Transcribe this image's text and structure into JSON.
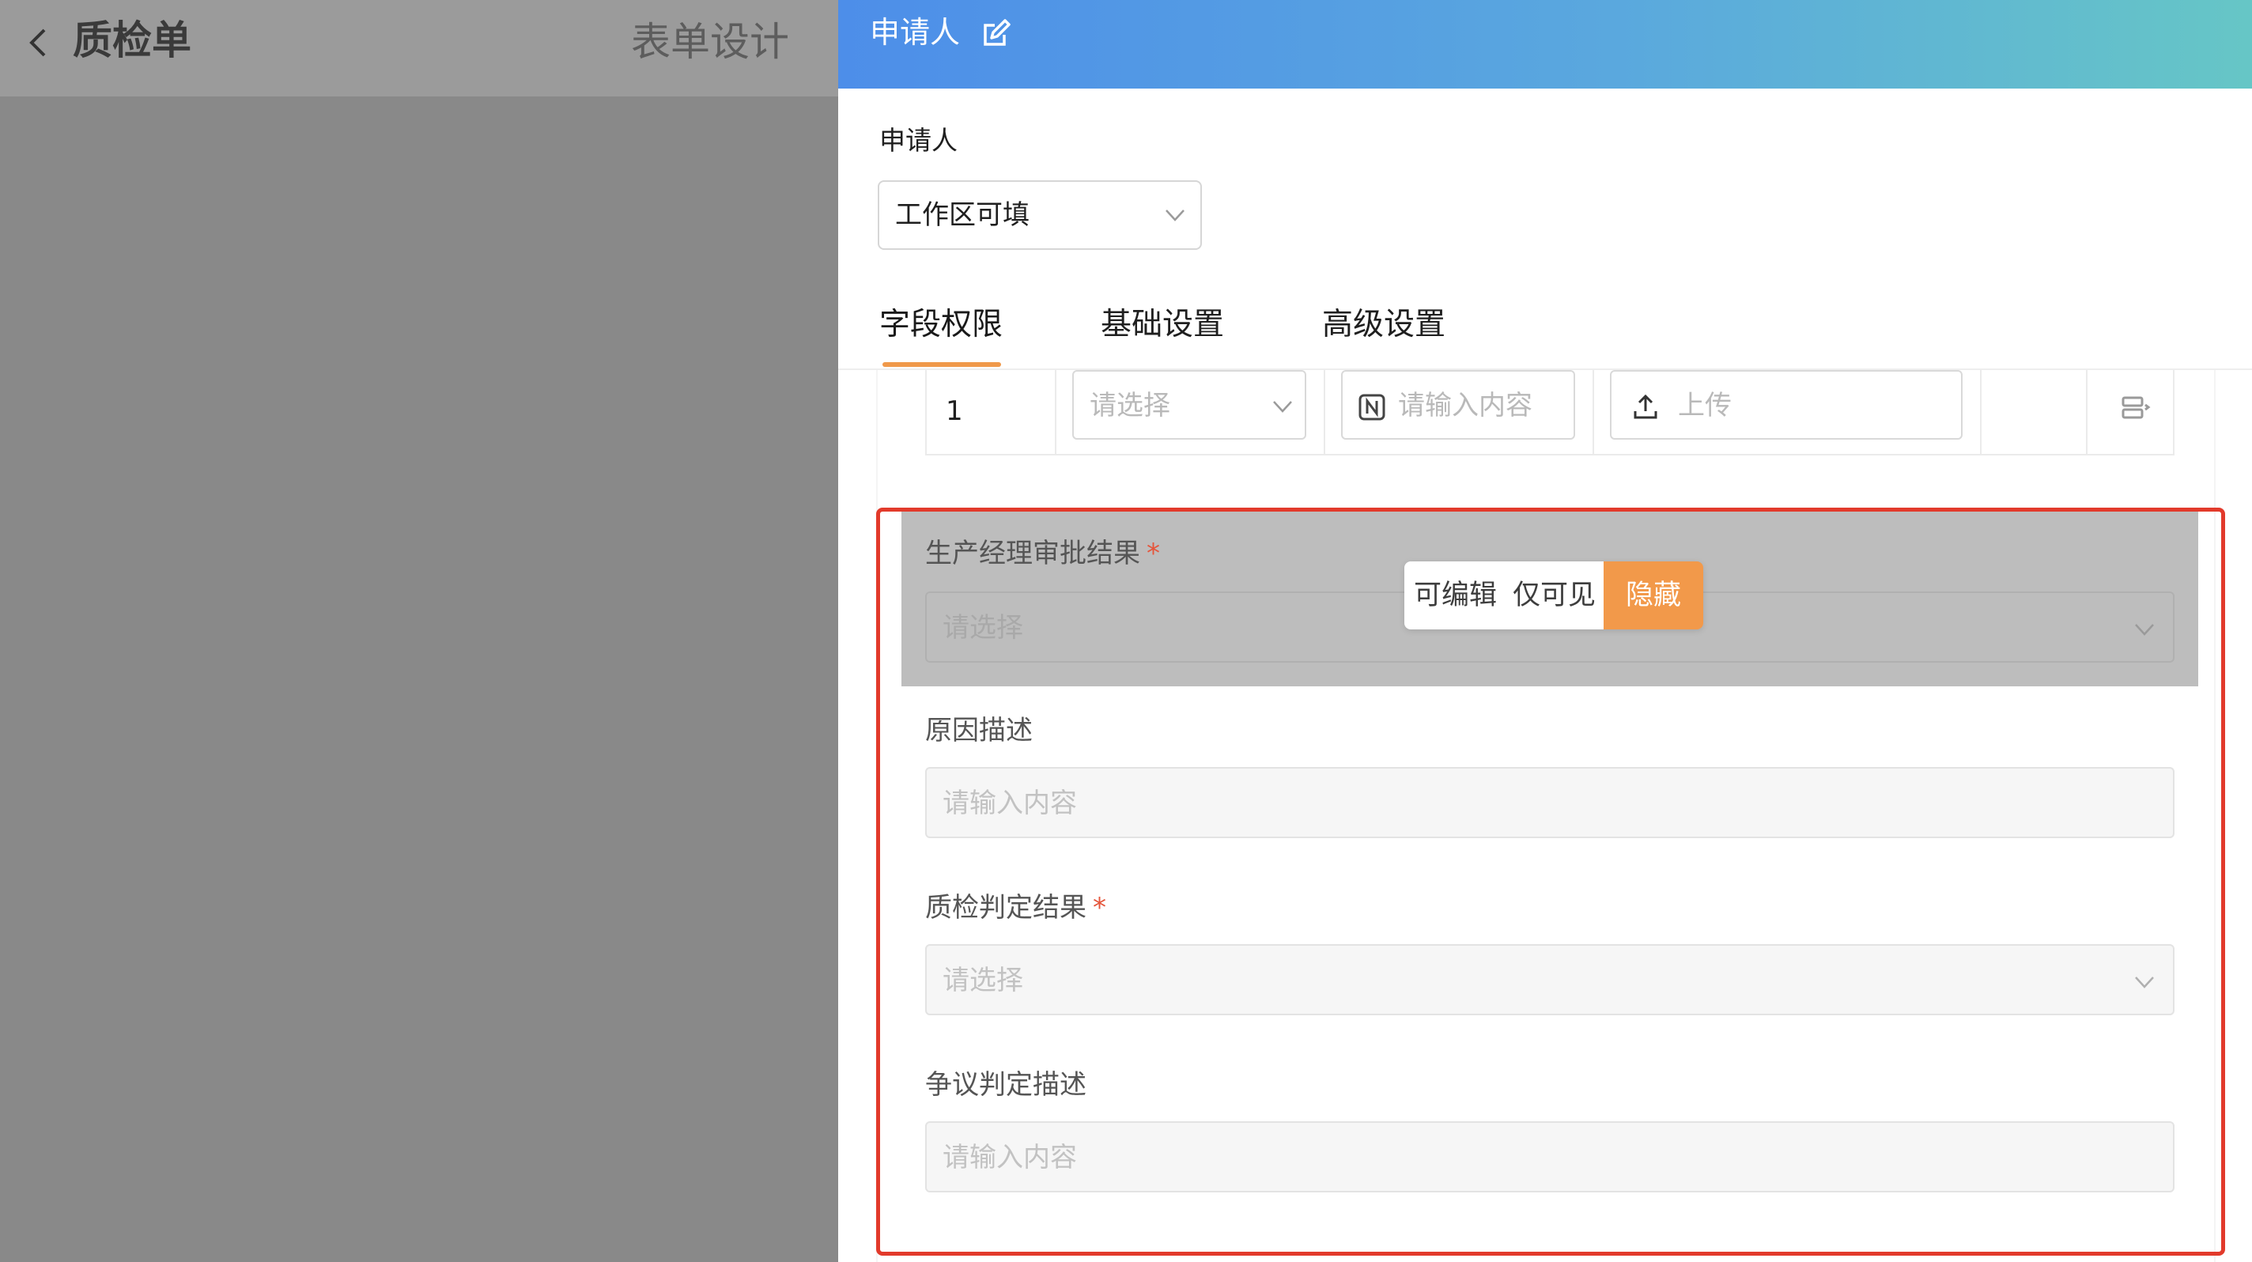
{
  "background_page": {
    "title": "质检单",
    "tab_design": "表单设计"
  },
  "drawer": {
    "title": "申请人",
    "node_label": "申请人",
    "node_select_value": "工作区可填",
    "tabs": [
      {
        "label": "字段权限",
        "active": true
      },
      {
        "label": "基础设置",
        "active": false
      },
      {
        "label": "高级设置",
        "active": false
      }
    ]
  },
  "subtable_row": {
    "index": "1",
    "select_placeholder": "请选择",
    "number_placeholder": "请输入内容",
    "upload_label": "上传"
  },
  "fields": [
    {
      "label": "生产经理审批结果",
      "required": true,
      "placeholder": "请选择",
      "type": "select",
      "permission": "隐藏"
    },
    {
      "label": "原因描述",
      "required": false,
      "placeholder": "请输入内容",
      "type": "input"
    },
    {
      "label": "质检判定结果",
      "required": true,
      "placeholder": "请选择",
      "type": "select"
    },
    {
      "label": "争议判定描述",
      "required": false,
      "placeholder": "请输入内容",
      "type": "input"
    }
  ],
  "permission_options": [
    "可编辑",
    "仅可见",
    "隐藏"
  ],
  "required_mark": "*",
  "colors": {
    "accent": "#f2994a",
    "header_gradient_start": "#4d8ee9",
    "header_gradient_end": "#66c6c6",
    "highlight": "#e23a2b"
  }
}
